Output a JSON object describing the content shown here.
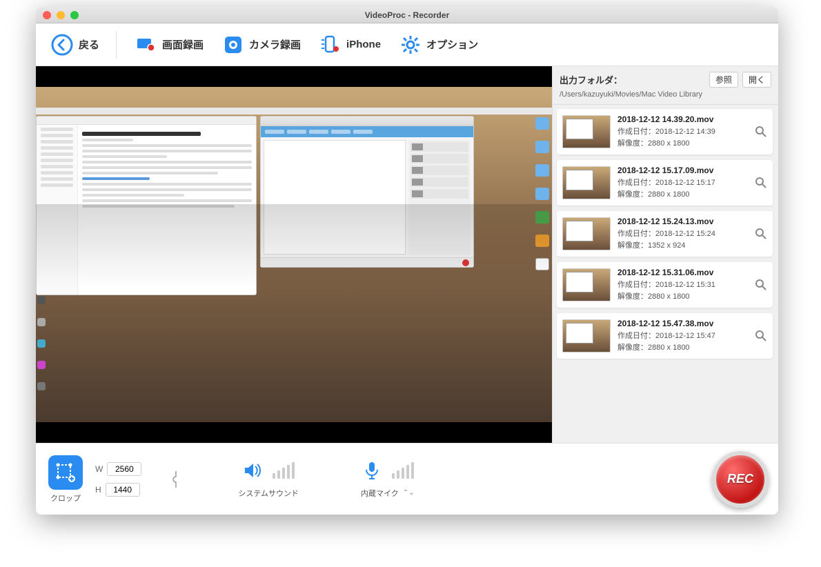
{
  "window": {
    "title": "VideoProc - Recorder"
  },
  "toolbar": {
    "back": "戻る",
    "screen_rec": "画面録画",
    "camera_rec": "カメラ録画",
    "iphone": "iPhone",
    "options": "オプション"
  },
  "side": {
    "header": "出力フォルダ：",
    "browse": "参照",
    "open": "開く",
    "path": "/Users/kazuyuki/Movies/Mac Video Library",
    "created_label": "作成日付：",
    "resolution_label": "解像度：",
    "items": [
      {
        "filename": "2018-12-12 14.39.20.mov",
        "created": "2018-12-12 14:39",
        "resolution": "2880 x 1800"
      },
      {
        "filename": "2018-12-12 15.17.09.mov",
        "created": "2018-12-12 15:17",
        "resolution": "2880 x 1800"
      },
      {
        "filename": "2018-12-12 15.24.13.mov",
        "created": "2018-12-12 15:24",
        "resolution": "1352 x 924"
      },
      {
        "filename": "2018-12-12 15.31.06.mov",
        "created": "2018-12-12 15:31",
        "resolution": "2880 x 1800"
      },
      {
        "filename": "2018-12-12 15.47.38.mov",
        "created": "2018-12-12 15:47",
        "resolution": "2880 x 1800"
      }
    ]
  },
  "bottom": {
    "crop": "クロップ",
    "w_label": "W",
    "h_label": "H",
    "width": "2560",
    "height": "1440",
    "system_sound": "システムサウンド",
    "builtin_mic": "内蔵マイク",
    "rec": "REC"
  },
  "colors": {
    "accent": "#2a8cf0"
  }
}
